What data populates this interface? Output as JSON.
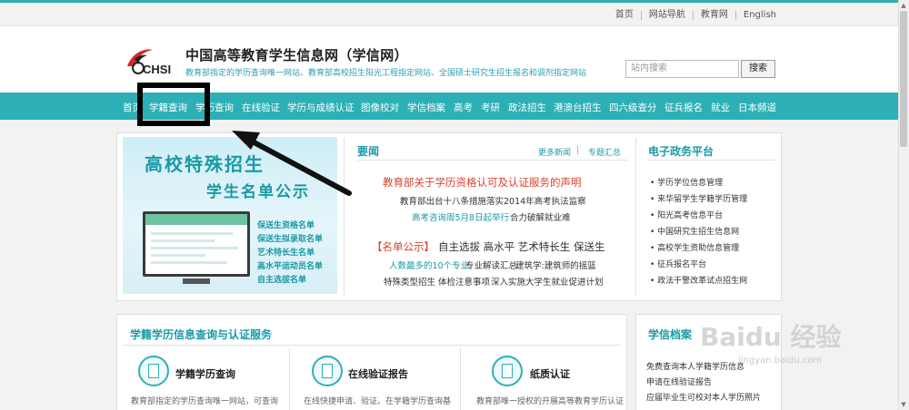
{
  "topbar": {
    "links": [
      "首页",
      "网站导航",
      "教育网",
      "English"
    ]
  },
  "header": {
    "logo_text": "CHSI",
    "title": "中国高等教育学生信息网（学信网）",
    "subtitle": "教育部指定的学历查询唯一网站、教育部高校招生阳光工程指定网站、全国硕士研究生招生报名和调剂指定网站",
    "search_placeholder": "站内搜索",
    "search_button": "搜索"
  },
  "nav": {
    "items": [
      "首页",
      "学籍查询",
      "学历查询",
      "在线验证",
      "学历与成绩认证",
      "图像校对",
      "学信档案",
      "高考",
      "考研",
      "政法招生",
      "港澳台招生",
      "四六级查分",
      "征兵报名",
      "就业",
      "日本频道"
    ]
  },
  "banner": {
    "title": "高校特殊招生",
    "subtitle": "学生名单公示",
    "list": [
      "保送生资格名单",
      "保送生拟录取名单",
      "艺术特长生名单",
      "高水平运动员名单",
      "自主选拔名单"
    ]
  },
  "news": {
    "title": "要闻",
    "more_links": [
      "更多新闻",
      "专题汇总"
    ],
    "headline": "教育部关于学历资格认可及认证服务的声明",
    "line1": "教育部出台十八条措施落实2014年高考执法监察",
    "line2_teal": "高考咨询周5月8日起举行",
    "line2_black": "合力破解就业难",
    "feature_bracket": "【名单公示】",
    "feature_rest": "自主选拔 高水平 艺术特长生 保送生",
    "line4_teal": "人数最多的10个专业",
    "line4_black1": "专业解读汇总",
    "line4_black2": "建筑学:建筑师的摇篮",
    "line5_a": "特殊类型招生 体检注意事项",
    "line5_b": "深入实施大学生就业促进计划"
  },
  "egov": {
    "title": "电子政务平台",
    "items": [
      "学历学位信息管理",
      "来华留学生学籍学历管理",
      "阳光高考信息平台",
      "中国研究生招生信息网",
      "高校学生资助信息管理",
      "征兵报名平台",
      "政法干警改革试点招生网"
    ]
  },
  "services": {
    "title": "学籍学历信息查询与认证服务",
    "items": [
      {
        "title": "学籍学历查询",
        "desc": "教育部指定的学历查询唯一网站，可查询"
      },
      {
        "title": "在线验证报告",
        "desc": "在线快捷申请、验证。在学籍学历查询基"
      },
      {
        "title": "纸质认证",
        "desc": "教育部唯一授权的开展高等教育学历认证"
      }
    ]
  },
  "archive": {
    "title": "学信档案",
    "items": [
      "免费查询本人学籍学历信息",
      "申请在线验证报告",
      "应届毕业生可校对本人学历照片"
    ]
  },
  "watermark": {
    "text": "Baidu 经验",
    "sub": "jingyan.baidu.com"
  },
  "colors": {
    "accent": "#2db0b5",
    "teal_text": "#1a9aa6",
    "red_text": "#d9412f"
  }
}
